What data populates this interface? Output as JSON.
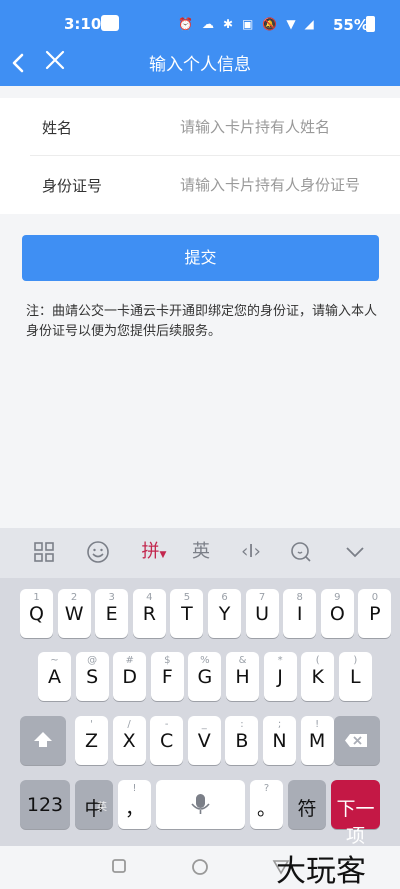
{
  "status_bar": {
    "time": "3:10",
    "battery": "55%",
    "icons": [
      "alarm-icon",
      "weather-icon",
      "bluetooth-icon",
      "volte-icon",
      "mute-icon",
      "wifi-icon",
      "signal-4g-icon",
      "battery-icon"
    ]
  },
  "header": {
    "title": "输入个人信息"
  },
  "form": {
    "name_label": "姓名",
    "name_placeholder": "请输入卡片持有人姓名",
    "id_label": "身份证号",
    "id_placeholder": "请输入卡片持有人身份证号"
  },
  "submit_label": "提交",
  "note": "注：曲靖公交一卡通云卡开通即绑定您的身份证，请输入本人身份证号以便为您提供后续服务。",
  "keyboard": {
    "tools": {
      "pinyin": "拼",
      "english": "英"
    },
    "row1": [
      {
        "main": "Q",
        "sub": "1"
      },
      {
        "main": "W",
        "sub": "2"
      },
      {
        "main": "E",
        "sub": "3"
      },
      {
        "main": "R",
        "sub": "4"
      },
      {
        "main": "T",
        "sub": "5"
      },
      {
        "main": "Y",
        "sub": "6"
      },
      {
        "main": "U",
        "sub": "7"
      },
      {
        "main": "I",
        "sub": "8"
      },
      {
        "main": "O",
        "sub": "9"
      },
      {
        "main": "P",
        "sub": "0"
      }
    ],
    "row2": [
      {
        "main": "A",
        "sub": "~"
      },
      {
        "main": "S",
        "sub": "@"
      },
      {
        "main": "D",
        "sub": "#"
      },
      {
        "main": "F",
        "sub": "$"
      },
      {
        "main": "G",
        "sub": "%"
      },
      {
        "main": "H",
        "sub": "&"
      },
      {
        "main": "J",
        "sub": "*"
      },
      {
        "main": "K",
        "sub": "("
      },
      {
        "main": "L",
        "sub": ")"
      }
    ],
    "row3": [
      {
        "main": "Z",
        "sub": "'"
      },
      {
        "main": "X",
        "sub": "/"
      },
      {
        "main": "C",
        "sub": "-"
      },
      {
        "main": "V",
        "sub": "_"
      },
      {
        "main": "B",
        "sub": ":"
      },
      {
        "main": "N",
        "sub": ";"
      },
      {
        "main": "M",
        "sub": "!"
      }
    ],
    "num_key": "123",
    "cn_key": "中",
    "cn_key_sub": "英",
    "comma_key": "，",
    "comma_sub": "!",
    "period_key": "。",
    "period_sub": "?",
    "symbol_key": "符",
    "next_key": "下一项"
  },
  "watermark": "大玩客"
}
